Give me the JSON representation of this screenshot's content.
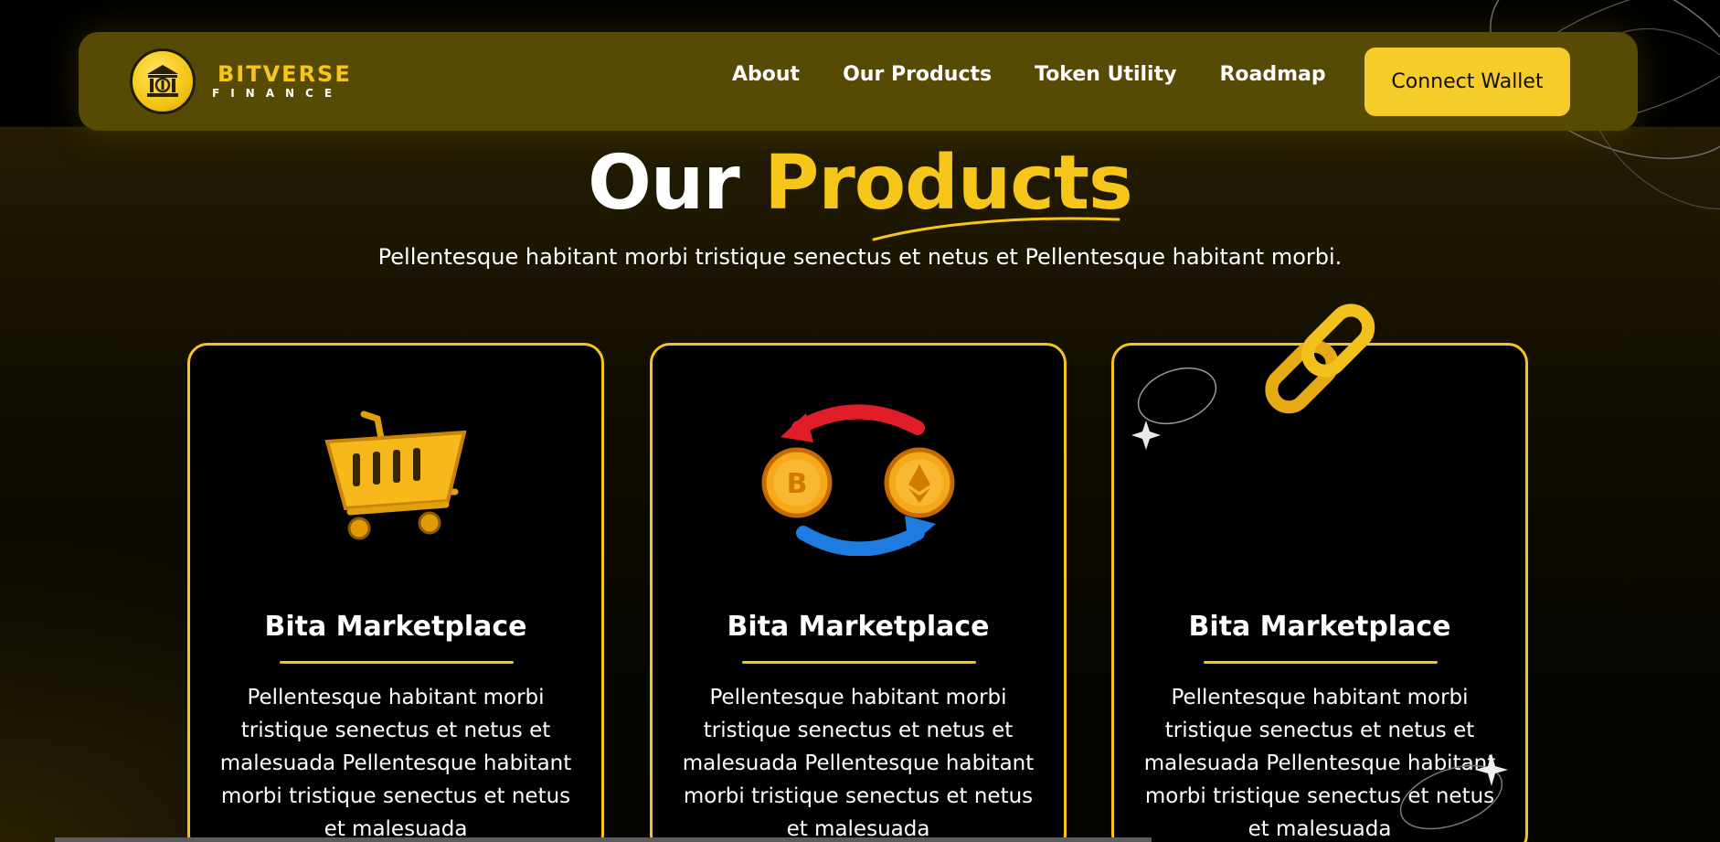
{
  "brand": {
    "name": "BITVERSE",
    "subname": "FINANCE",
    "logo_icon": "bank-coin-icon"
  },
  "nav": {
    "links": [
      "About",
      "Our Products",
      "Token Utility",
      "Roadmap"
    ],
    "cta_label": "Connect Wallet"
  },
  "section": {
    "title_part1": "Our",
    "title_part2": "Products",
    "subtitle": "Pellentesque habitant morbi tristique senectus et netus et Pellentesque habitant morbi."
  },
  "cards": [
    {
      "icon": "shopping-cart-icon",
      "title": "Bita Marketplace",
      "description": "Pellentesque habitant morbi tristique senectus et netus et malesuada Pellentesque habitant morbi tristique senectus et netus et malesuada"
    },
    {
      "icon": "crypto-swap-icon",
      "title": "Bita Marketplace",
      "description": "Pellentesque habitant morbi tristique senectus et netus et malesuada Pellentesque habitant morbi tristique senectus et netus et malesuada"
    },
    {
      "icon": "chain-link-icon",
      "title": "Bita Marketplace",
      "description": "Pellentesque habitant morbi tristique senectus et netus et malesuada Pellentesque habitant morbi tristique senectus et netus et malesuada"
    }
  ],
  "colors": {
    "accent": "#f7c61a",
    "navbar_bg": "#574a04",
    "button_bg": "#f6cc2a",
    "card_border": "#f5c51b"
  }
}
